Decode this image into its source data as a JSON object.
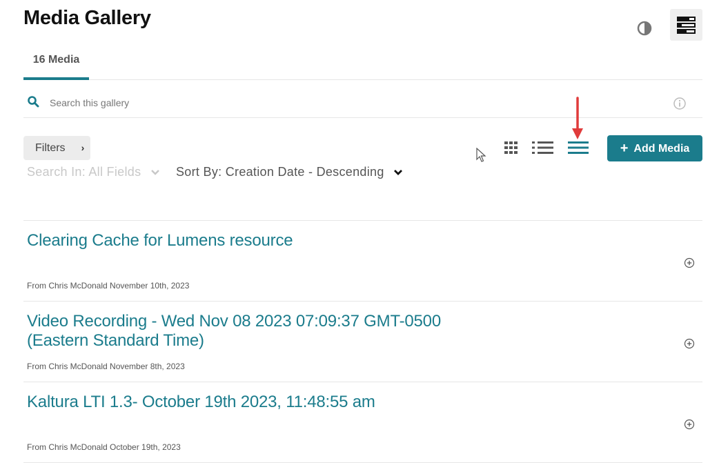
{
  "header": {
    "title": "Media Gallery",
    "contrast_icon": "contrast-icon",
    "layout_icon": "layout-toggle-icon"
  },
  "tabs": [
    {
      "label": "16 Media",
      "active": true
    }
  ],
  "search": {
    "placeholder": "Search this gallery",
    "value": "",
    "icon": "search-icon",
    "info_icon": "info-icon"
  },
  "toolbar": {
    "filters_label": "Filters",
    "search_in_label": "Search In: All Fields",
    "sort_by_label": "Sort By: Creation Date - Descending",
    "view_modes": [
      {
        "name": "grid-view",
        "active": false
      },
      {
        "name": "detailed-list-view",
        "active": false
      },
      {
        "name": "compact-list-view",
        "active": true
      }
    ],
    "add_media_label": "Add Media"
  },
  "annotation": {
    "arrow_color": "#e03b3b",
    "points_to": "compact-list-view"
  },
  "colors": {
    "accent": "#1b7c8c",
    "tab_underline": "#1b7c8c",
    "filters_bg": "#ececec"
  },
  "entries": [
    {
      "title": "Clearing Cache for Lumens resource",
      "meta": "From Chris McDonald November 10th, 2023"
    },
    {
      "title": "Video Recording - Wed Nov 08 2023 07:09:37 GMT-0500 (Eastern Standard Time)",
      "meta": "From Chris McDonald November 8th, 2023"
    },
    {
      "title": "Kaltura LTI 1.3- October 19th 2023, 11:48:55 am",
      "meta": "From Chris McDonald October 19th, 2023"
    }
  ]
}
